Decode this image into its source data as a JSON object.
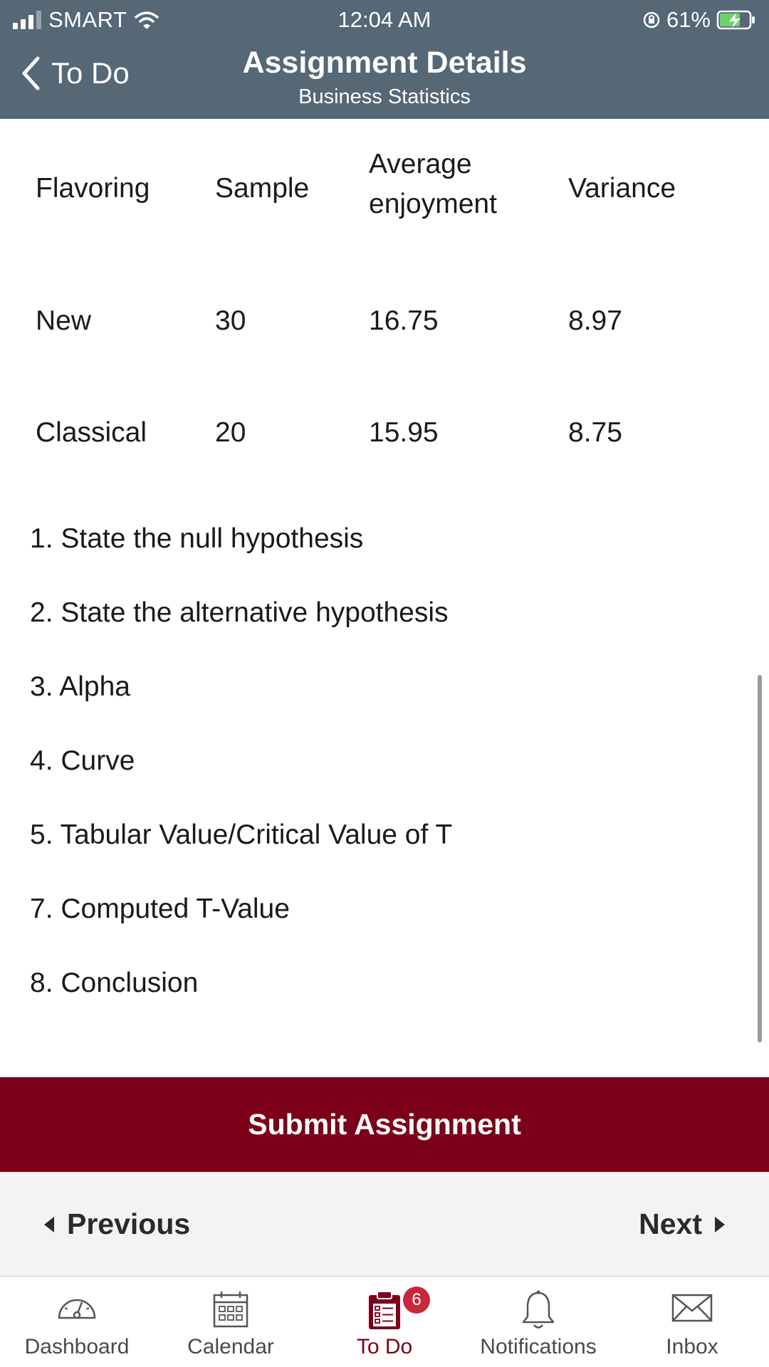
{
  "status_bar": {
    "carrier": "SMART",
    "time": "12:04 AM",
    "battery": "61%"
  },
  "nav": {
    "back_label": "To Do",
    "title": "Assignment Details",
    "subtitle": "Business Statistics"
  },
  "table": {
    "headers": {
      "flavoring": "Flavoring",
      "sample": "Sample",
      "avg_line1": "Average",
      "avg_line2": "enjoyment",
      "variance": "Variance"
    },
    "rows": [
      {
        "flavoring": "New",
        "sample": "30",
        "average": "16.75",
        "variance": "8.97"
      },
      {
        "flavoring": "Classical",
        "sample": "20",
        "average": "15.95",
        "variance": "8.75"
      }
    ]
  },
  "questions": [
    "1. State the null hypothesis",
    "2. State the alternative hypothesis",
    "3. Alpha",
    "4. Curve",
    "5. Tabular Value/Critical Value of T",
    "7. Computed T-Value",
    "8. Conclusion"
  ],
  "submit_label": "Submit Assignment",
  "pager": {
    "previous": "Previous",
    "next": "Next"
  },
  "tabs": [
    {
      "label": "Dashboard",
      "icon": "gauge-icon"
    },
    {
      "label": "Calendar",
      "icon": "calendar-icon"
    },
    {
      "label": "To Do",
      "icon": "clipboard-list-icon",
      "badge": "6",
      "active": true
    },
    {
      "label": "Notifications",
      "icon": "bell-icon"
    },
    {
      "label": "Inbox",
      "icon": "envelope-icon"
    }
  ],
  "colors": {
    "header_bg": "#566776",
    "submit_bg": "#7c0019",
    "active_tab": "#7c0019",
    "badge": "#c8283a"
  }
}
